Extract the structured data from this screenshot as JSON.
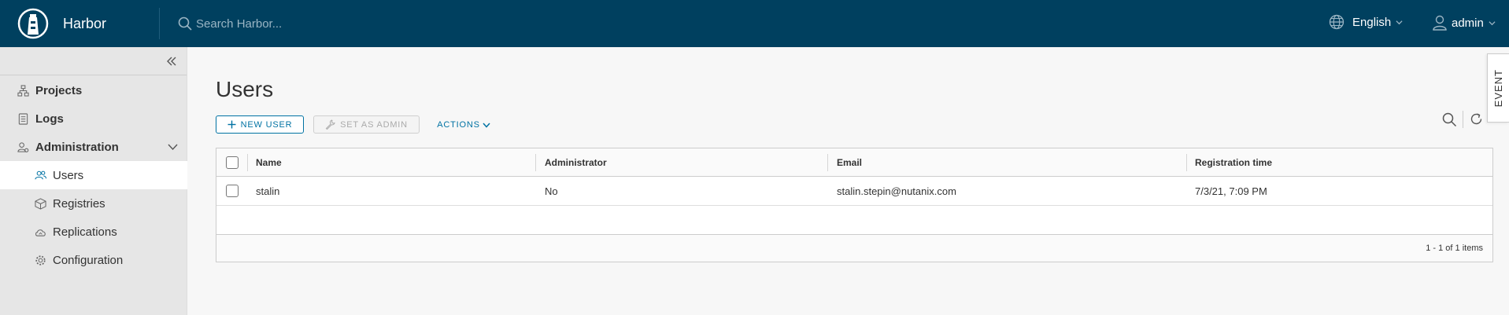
{
  "header": {
    "app_name": "Harbor",
    "search_placeholder": "Search Harbor...",
    "language": "English",
    "user": "admin"
  },
  "sidebar": {
    "items": [
      {
        "label": "Projects",
        "icon": "projects-icon"
      },
      {
        "label": "Logs",
        "icon": "logs-icon"
      },
      {
        "label": "Administration",
        "icon": "administration-icon",
        "expanded": true
      },
      {
        "label": "Users",
        "icon": "users-icon",
        "active": true
      },
      {
        "label": "Registries",
        "icon": "registries-icon"
      },
      {
        "label": "Replications",
        "icon": "replications-icon"
      },
      {
        "label": "Configuration",
        "icon": "configuration-icon"
      }
    ]
  },
  "page": {
    "title": "Users",
    "new_user_label": "NEW USER",
    "set_admin_label": "SET AS ADMIN",
    "actions_label": "ACTIONS",
    "event_tab": "EVENT"
  },
  "table": {
    "columns": [
      "Name",
      "Administrator",
      "Email",
      "Registration time"
    ],
    "rows": [
      {
        "name": "stalin",
        "administrator": "No",
        "email": "stalin.stepin@nutanix.com",
        "registration": "7/3/21, 7:09 PM"
      }
    ],
    "footer": "1 - 1 of 1 items"
  },
  "colors": {
    "header_bg": "#00405f",
    "accent": "#0072a3",
    "sidebar_bg": "#e6e6e6"
  }
}
